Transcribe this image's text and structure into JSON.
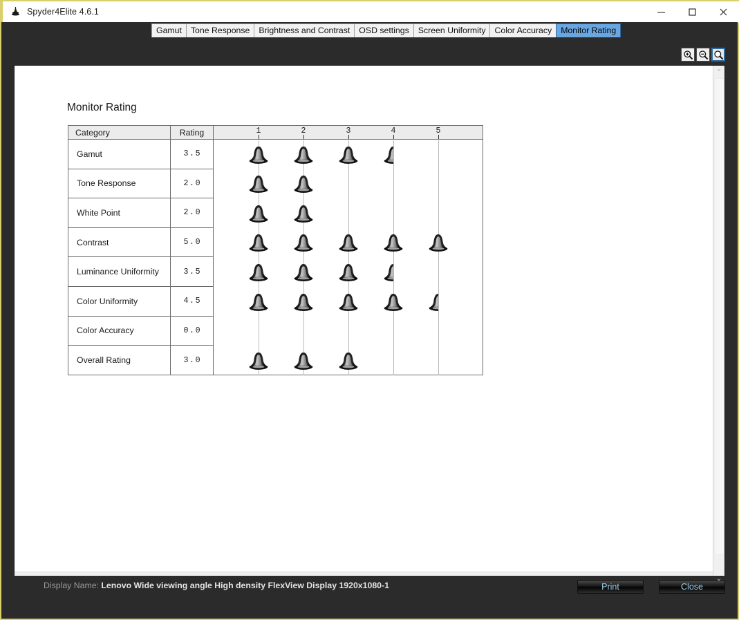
{
  "window": {
    "title": "Spyder4Elite 4.6.1",
    "app_icon": "spyder-icon",
    "minimize_label": "—",
    "maximize_label": "□",
    "close_label": "✕"
  },
  "tabs": [
    {
      "label": "Gamut",
      "active": false
    },
    {
      "label": "Tone Response",
      "active": false
    },
    {
      "label": "Brightness and Contrast",
      "active": false
    },
    {
      "label": "OSD settings",
      "active": false
    },
    {
      "label": "Screen Uniformity",
      "active": false
    },
    {
      "label": "Color Accuracy",
      "active": false
    },
    {
      "label": "Monitor Rating",
      "active": true
    }
  ],
  "toolbar": {
    "zoom_in": "zoom-in",
    "zoom_out": "zoom-out",
    "zoom_actual": "zoom-actual"
  },
  "report": {
    "title": "Monitor Rating",
    "columns": {
      "category": "Category",
      "rating": "Rating"
    },
    "scale_labels": [
      "1",
      "2",
      "3",
      "4",
      "5"
    ]
  },
  "chart_data": {
    "type": "bar",
    "title": "Monitor Rating",
    "xlabel": "",
    "ylabel": "",
    "xlim": [
      0,
      5.5
    ],
    "grid": true,
    "legend": "none",
    "units": "bells",
    "categories": [
      "Gamut",
      "Tone Response",
      "White Point",
      "Contrast",
      "Luminance Uniformity",
      "Color Uniformity",
      "Color Accuracy",
      "Overall Rating"
    ],
    "values": [
      3.5,
      2.0,
      2.0,
      5.0,
      3.5,
      4.5,
      0.0,
      3.0
    ],
    "value_labels": [
      "3.5",
      "2.0",
      "2.0",
      "5.0",
      "3.5",
      "4.5",
      "0.0",
      "3.0"
    ],
    "tick_labels": [
      "1",
      "2",
      "3",
      "4",
      "5"
    ],
    "tick_values": [
      1,
      2,
      3,
      4,
      5
    ]
  },
  "statusbar": {
    "display_label": "Display Name:",
    "display_value": "Lenovo Wide viewing angle  High density FlexView Display 1920x1080-1",
    "print_label": "Print",
    "close_label": "Close"
  },
  "scrollbars": {
    "up": "⌃",
    "down": "⌄",
    "left": "‹",
    "right": "›"
  }
}
